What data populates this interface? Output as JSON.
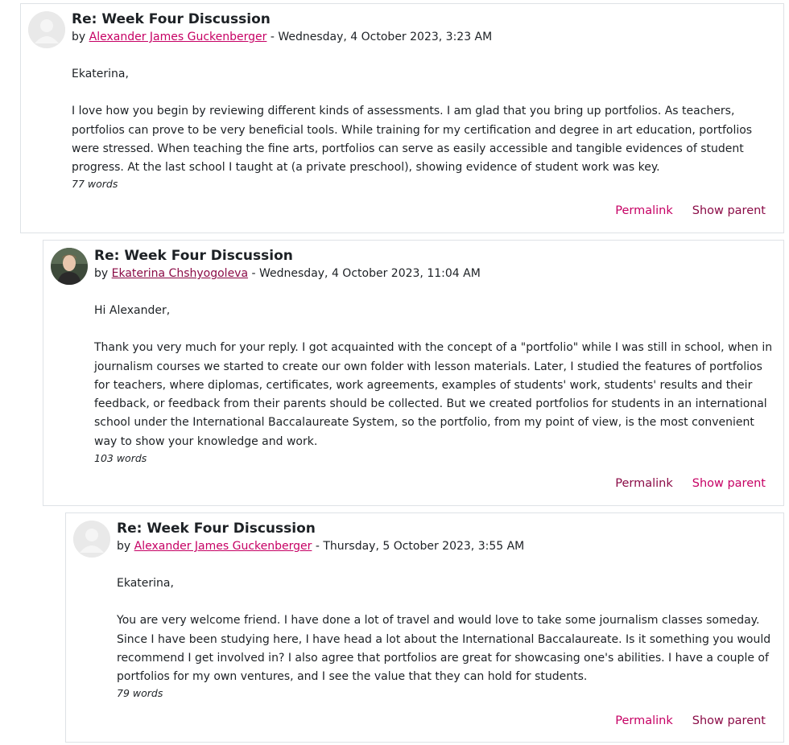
{
  "posts": [
    {
      "subject": "Re: Week Four Discussion",
      "by_prefix": "by",
      "author": "Alexander James Guckenberger",
      "date_sep": " - ",
      "date": "Wednesday, 4 October 2023, 3:23 AM",
      "avatar": "default-user-avatar",
      "greeting": "Ekaterina,",
      "body": "I love how you begin by reviewing different kinds of assessments. I am glad that you bring up portfolios. As teachers, portfolios can prove to be very beneficial tools. While training for my certification and degree in art education, portfolios were stressed. When teaching the fine arts, portfolios can serve as easily accessible and tangible evidences of student progress. At the last school I taught at (a private preschool), showing evidence of student work was key.",
      "word_count": "77 words",
      "permalink": "Permalink",
      "show_parent": "Show parent"
    },
    {
      "subject": "Re: Week Four Discussion",
      "by_prefix": "by",
      "author": "Ekaterina Chshyogoleva",
      "date_sep": " - ",
      "date": "Wednesday, 4 October 2023, 11:04 AM",
      "avatar": "user-photo-avatar",
      "greeting": "Hi Alexander,",
      "body": "Thank you very much for your reply. I got acquainted with the concept of a \"portfolio\" while I was still in school, when in journalism courses we started to create our own folder with lesson materials. Later, I studied the features of portfolios for teachers, where diplomas, certificates, work agreements, examples of students' work, students' results and their feedback, or feedback from their parents should be collected. But we created portfolios for students in an international school under the International Baccalaureate System, so the portfolio, from my point of view, is the most convenient way to show your knowledge and work.",
      "word_count": "103 words",
      "permalink": "Permalink",
      "show_parent": "Show parent"
    },
    {
      "subject": "Re: Week Four Discussion",
      "by_prefix": "by",
      "author": "Alexander James Guckenberger",
      "date_sep": " - ",
      "date": "Thursday, 5 October 2023, 3:55 AM",
      "avatar": "default-user-avatar",
      "greeting": "Ekaterina,",
      "body": "You are very welcome friend. I have done a lot of travel and would love to take some journalism classes someday. Since I have been studying here, I have head a lot about the International Baccalaureate. Is it something you would recommend I get involved in? I also agree that portfolios are great for showcasing one's abilities. I have a couple of portfolios for my own ventures, and I see the value that they can hold for students.",
      "word_count": "79 words",
      "permalink": "Permalink",
      "show_parent": "Show parent"
    }
  ],
  "colors": {
    "link": "#c60064",
    "link_visited": "#8a0b46",
    "border": "#dee2e6",
    "text": "#1d2125"
  }
}
